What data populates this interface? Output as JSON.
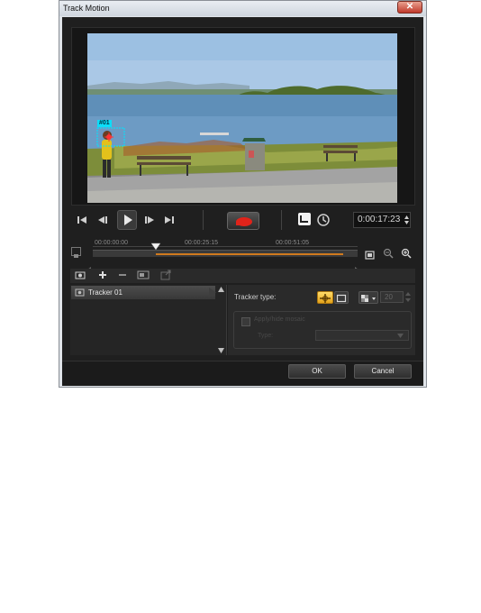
{
  "window": {
    "title": "Track Motion",
    "close_glyph": "✕"
  },
  "preview": {
    "tracker_tag": "#01"
  },
  "playback": {
    "timecode": "0:00:17:23"
  },
  "timeline": {
    "ticks": [
      "00:00:00:00",
      "00:00:25:15",
      "00:00:51:05"
    ]
  },
  "tracker_list": {
    "items": [
      {
        "label": "Tracker 01"
      }
    ]
  },
  "properties": {
    "tracker_type_label": "Tracker type:",
    "mosaic_size": "20",
    "mosaic_option_label": "Apply/hide mosaic",
    "mosaic_type_label": "Type:"
  },
  "buttons": {
    "ok_label": "OK",
    "cancel_label": "Cancel"
  },
  "colors": {
    "accent_orange": "#d07a1e",
    "tracker_cyan": "#00e5ff",
    "selection_yellow": "#ffcc33"
  }
}
